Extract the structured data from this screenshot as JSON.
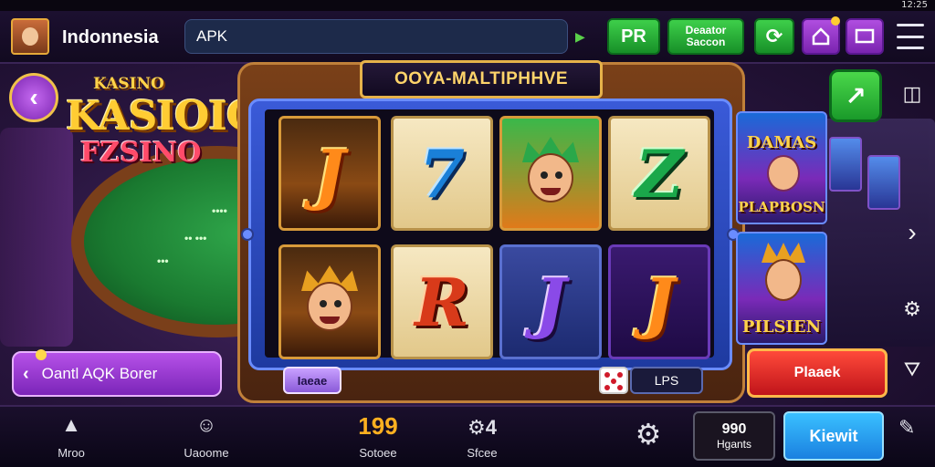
{
  "status_bar": {
    "time": "12:25",
    "icons": [
      "wifi-icon",
      "signal-icon",
      "battery-icon"
    ]
  },
  "header": {
    "region": "Indonnesia",
    "search": {
      "value": "APK",
      "placeholder": ""
    },
    "buttons": {
      "pr": "PR",
      "deposit": "Deaator Saccon",
      "refresh_icon": "refresh-icon",
      "home_icon": "home-icon",
      "screen_icon": "screen-icon",
      "menu_icon": "menu-icon"
    }
  },
  "logo": {
    "line1": "KASINO",
    "line2": "KASIOIO",
    "line3": "FZSINO"
  },
  "table": {
    "text1": "••••",
    "text2": "•• •••",
    "text3": "•••"
  },
  "promo_button": {
    "label": "Oantl AQK Borer"
  },
  "machine": {
    "title": "OOYA-MALTIPHHVE",
    "reels": [
      [
        "J",
        "face"
      ],
      [
        "7",
        "R"
      ],
      [
        "face",
        "J"
      ],
      [
        "Z",
        "J"
      ]
    ],
    "bet_label": "Iaeae",
    "lines_label": "LPS"
  },
  "right_panel": {
    "card1": {
      "line1": "DAMAS",
      "line2": "PLAPBOSN"
    },
    "card2": {
      "line1": "PILSIEN"
    },
    "action_button": "Plaaek"
  },
  "bottom_nav": {
    "items": [
      {
        "icon": "thumbs-up-icon",
        "label": "Mroo"
      },
      {
        "icon": "user-icon",
        "label": "Uaoome"
      },
      {
        "value": "199",
        "label": "Sotoee"
      },
      {
        "value": "4",
        "label": "Sfcee",
        "icon": "gear-icon"
      }
    ],
    "stat": {
      "value": "990",
      "label": "Hgants"
    },
    "cta": "Kiewit"
  },
  "colors": {
    "accent_green": "#2cb83c",
    "accent_purple": "#9a3ad0",
    "accent_gold": "#ffb020",
    "cta_blue": "#2aa0f0",
    "danger_red": "#e0241f"
  }
}
